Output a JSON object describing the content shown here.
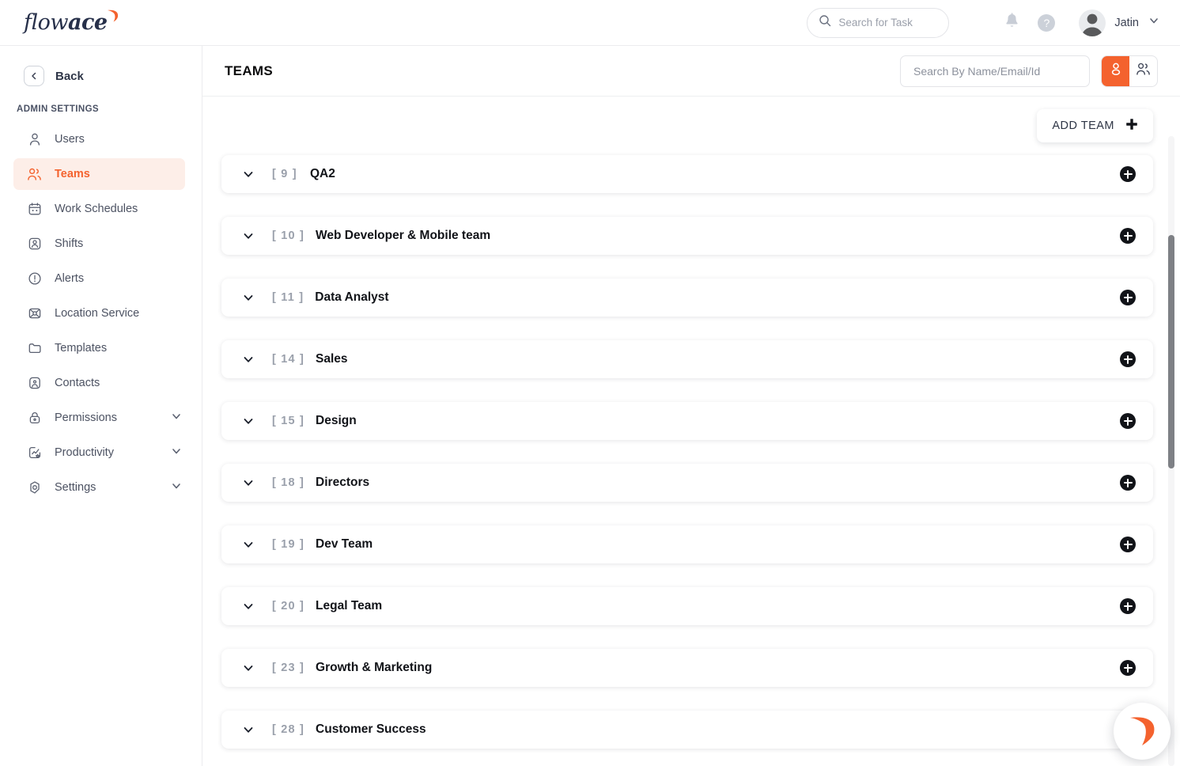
{
  "brand": {
    "logo_flow": "flow",
    "logo_ace": "ace",
    "accent_color": "#f4622e",
    "logo_text_color": "#27304a"
  },
  "topbar": {
    "task_search_placeholder": "Search for Task",
    "task_search_value": "",
    "notifications_icon": "bell-icon",
    "help_icon": "help-icon",
    "help_label": "?",
    "user_name": "Jatin",
    "user_menu_icon": "chevron-down-icon"
  },
  "sidebar": {
    "back_label": "Back",
    "section_label": "ADMIN SETTINGS",
    "items": [
      {
        "label": "Users",
        "icon": "user-icon",
        "active": false,
        "expandable": false
      },
      {
        "label": "Teams",
        "icon": "users-icon",
        "active": true,
        "expandable": false
      },
      {
        "label": "Work Schedules",
        "icon": "calendar-icon",
        "active": false,
        "expandable": false
      },
      {
        "label": "Shifts",
        "icon": "shift-badge-icon",
        "active": false,
        "expandable": false
      },
      {
        "label": "Alerts",
        "icon": "alert-circle-icon",
        "active": false,
        "expandable": false
      },
      {
        "label": "Location Service",
        "icon": "location-icon",
        "active": false,
        "expandable": false
      },
      {
        "label": "Templates",
        "icon": "folder-icon",
        "active": false,
        "expandable": false
      },
      {
        "label": "Contacts",
        "icon": "contact-icon",
        "active": false,
        "expandable": false
      },
      {
        "label": "Permissions",
        "icon": "lock-icon",
        "active": false,
        "expandable": true
      },
      {
        "label": "Productivity",
        "icon": "chart-star-icon",
        "active": false,
        "expandable": true
      },
      {
        "label": "Settings",
        "icon": "gear-icon",
        "active": false,
        "expandable": true
      }
    ]
  },
  "page": {
    "title": "TEAMS",
    "search_placeholder": "Search By Name/Email/Id",
    "search_value": "",
    "view_toggle": [
      {
        "icon": "single-user-icon",
        "selected": true
      },
      {
        "icon": "group-users-icon",
        "selected": false
      }
    ],
    "add_team_label": "ADD TEAM",
    "add_team_icon": "plus-icon"
  },
  "teams": [
    {
      "count": "[ 9 ]",
      "name": "QA2"
    },
    {
      "count": "[ 10 ]",
      "name": "Web Developer & Mobile team"
    },
    {
      "count": "[ 11 ]",
      "name": "Data Analyst"
    },
    {
      "count": "[ 14 ]",
      "name": "Sales"
    },
    {
      "count": "[ 15 ]",
      "name": "Design"
    },
    {
      "count": "[ 18 ]",
      "name": "Directors"
    },
    {
      "count": "[ 19 ]",
      "name": "Dev Team"
    },
    {
      "count": "[ 20 ]",
      "name": "Legal Team"
    },
    {
      "count": "[ 23 ]",
      "name": "Growth & Marketing"
    },
    {
      "count": "[ 28 ]",
      "name": "Customer Success"
    }
  ],
  "chat_widget": {
    "icon": "flowace-swoosh-icon"
  }
}
